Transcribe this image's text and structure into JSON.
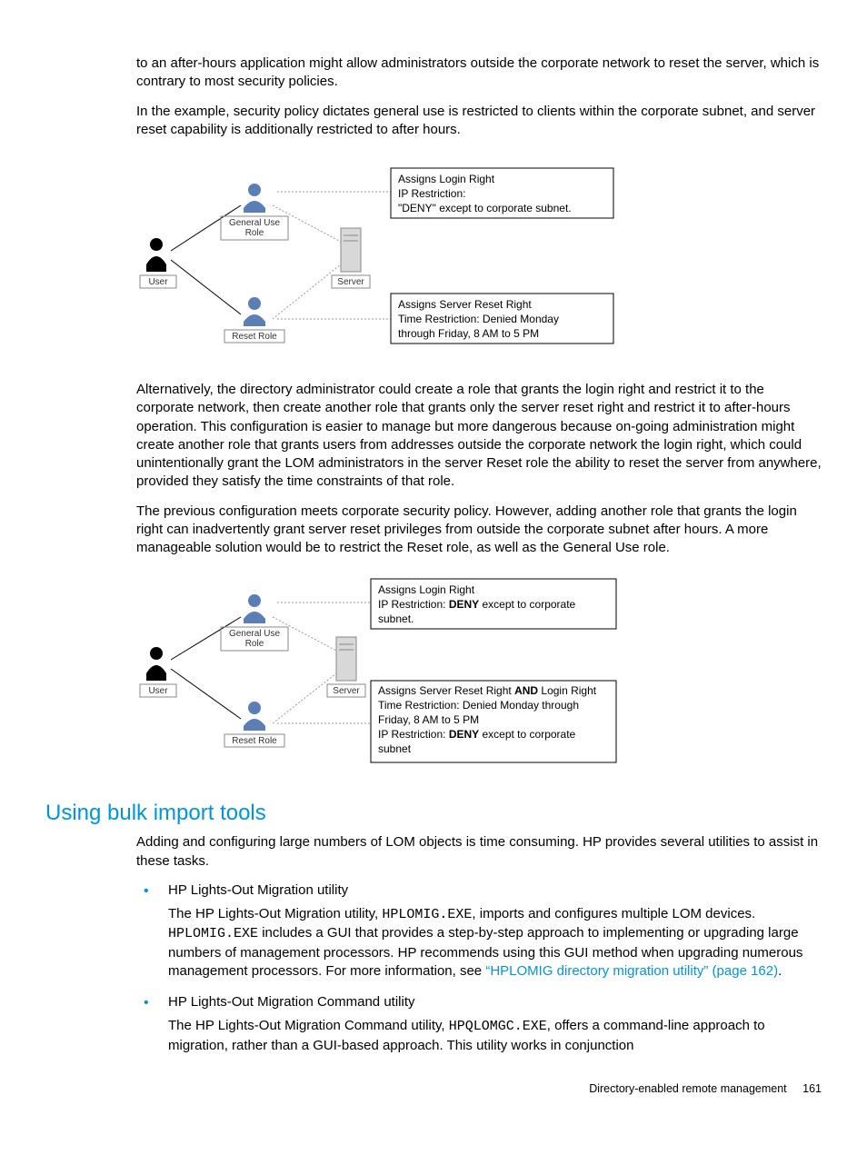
{
  "paragraphs": {
    "p1": "to an after-hours application might allow administrators outside the corporate network to reset the server, which is contrary to most security policies.",
    "p2": "In the example, security policy dictates general use is restricted to clients within the corporate subnet, and server reset capability is additionally restricted to after hours.",
    "p3": "Alternatively, the directory administrator could create a role that grants the login right and restrict it to the corporate network, then create another role that grants only the server reset right and restrict it to after-hours operation. This configuration is easier to manage but more dangerous because on-going administration might create another role that grants users from addresses outside the corporate network the login right, which could unintentionally grant the LOM administrators in the server Reset role the ability to reset the server from anywhere, provided they satisfy the time constraints of that role.",
    "p4": "The previous configuration meets corporate security policy. However, adding another role that grants the login right can inadvertently grant server reset privileges from outside the corporate subnet after hours. A more manageable solution would be to restrict the Reset role, as well as the General Use role.",
    "p5": "Adding and configuring large numbers of LOM objects is time consuming. HP provides several utilities to assist in these tasks."
  },
  "diagram1": {
    "user": "User",
    "general_role_l1": "General Use",
    "general_role_l2": "Role",
    "reset_role": "Reset Role",
    "server": "Server",
    "box1_l1": "Assigns Login Right",
    "box1_l2": "IP Restriction:",
    "box1_l3": "\"DENY\" except to corporate subnet.",
    "box2_l1": "Assigns Server Reset Right",
    "box2_l2": "Time Restriction: Denied Monday",
    "box2_l3": "through Friday, 8 AM to 5 PM"
  },
  "diagram2": {
    "user": "User",
    "general_role_l1": "General Use",
    "general_role_l2": "Role",
    "reset_role": "Reset Role",
    "server": "Server",
    "box1_l1": "Assigns Login Right",
    "box1_l2a": "IP Restriction: ",
    "box1_l2b": "DENY",
    "box1_l2c": " except to corporate",
    "box1_l3": "subnet.",
    "box2_l1a": "Assigns Server Reset Right ",
    "box2_l1b": "AND",
    "box2_l1c": " Login Right",
    "box2_l2": "Time Restriction: Denied Monday through",
    "box2_l3": "Friday, 8 AM to 5 PM",
    "box2_l4a": "IP Restriction: ",
    "box2_l4b": "DENY",
    "box2_l4c": " except to corporate",
    "box2_l5": "subnet"
  },
  "section_heading": "Using bulk import tools",
  "list": {
    "item1_title": "HP Lights-Out Migration utility",
    "item1_body_a": "The HP Lights-Out Migration utility, ",
    "item1_body_b": "HPLOMIG.EXE",
    "item1_body_c": ", imports and configures multiple LOM devices. ",
    "item1_body_d": "HPLOMIG.EXE",
    "item1_body_e": " includes a GUI that provides a step-by-step approach to implementing or upgrading large numbers of management processors. HP recommends using this GUI method when upgrading numerous management processors. For more information, see ",
    "item1_link": "“HPLOMIG directory migration utility” (page 162)",
    "item1_body_f": ".",
    "item2_title": "HP Lights-Out Migration Command utility",
    "item2_body_a": "The HP Lights-Out Migration Command utility, ",
    "item2_body_b": "HPQLOMGC.EXE",
    "item2_body_c": ", offers a command-line approach to migration, rather than a GUI-based approach. This utility works in conjunction"
  },
  "footer": {
    "section": "Directory-enabled remote management",
    "page": "161"
  }
}
